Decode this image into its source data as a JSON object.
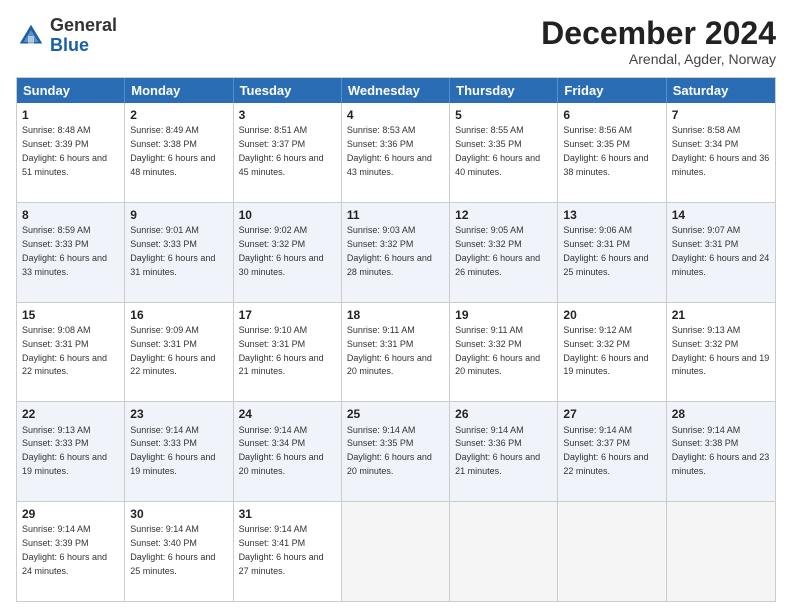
{
  "header": {
    "logo_general": "General",
    "logo_blue": "Blue",
    "month_title": "December 2024",
    "location": "Arendal, Agder, Norway"
  },
  "days_of_week": [
    "Sunday",
    "Monday",
    "Tuesday",
    "Wednesday",
    "Thursday",
    "Friday",
    "Saturday"
  ],
  "weeks": [
    [
      {
        "day": "1",
        "sunrise": "Sunrise: 8:48 AM",
        "sunset": "Sunset: 3:39 PM",
        "daylight": "Daylight: 6 hours and 51 minutes."
      },
      {
        "day": "2",
        "sunrise": "Sunrise: 8:49 AM",
        "sunset": "Sunset: 3:38 PM",
        "daylight": "Daylight: 6 hours and 48 minutes."
      },
      {
        "day": "3",
        "sunrise": "Sunrise: 8:51 AM",
        "sunset": "Sunset: 3:37 PM",
        "daylight": "Daylight: 6 hours and 45 minutes."
      },
      {
        "day": "4",
        "sunrise": "Sunrise: 8:53 AM",
        "sunset": "Sunset: 3:36 PM",
        "daylight": "Daylight: 6 hours and 43 minutes."
      },
      {
        "day": "5",
        "sunrise": "Sunrise: 8:55 AM",
        "sunset": "Sunset: 3:35 PM",
        "daylight": "Daylight: 6 hours and 40 minutes."
      },
      {
        "day": "6",
        "sunrise": "Sunrise: 8:56 AM",
        "sunset": "Sunset: 3:35 PM",
        "daylight": "Daylight: 6 hours and 38 minutes."
      },
      {
        "day": "7",
        "sunrise": "Sunrise: 8:58 AM",
        "sunset": "Sunset: 3:34 PM",
        "daylight": "Daylight: 6 hours and 36 minutes."
      }
    ],
    [
      {
        "day": "8",
        "sunrise": "Sunrise: 8:59 AM",
        "sunset": "Sunset: 3:33 PM",
        "daylight": "Daylight: 6 hours and 33 minutes."
      },
      {
        "day": "9",
        "sunrise": "Sunrise: 9:01 AM",
        "sunset": "Sunset: 3:33 PM",
        "daylight": "Daylight: 6 hours and 31 minutes."
      },
      {
        "day": "10",
        "sunrise": "Sunrise: 9:02 AM",
        "sunset": "Sunset: 3:32 PM",
        "daylight": "Daylight: 6 hours and 30 minutes."
      },
      {
        "day": "11",
        "sunrise": "Sunrise: 9:03 AM",
        "sunset": "Sunset: 3:32 PM",
        "daylight": "Daylight: 6 hours and 28 minutes."
      },
      {
        "day": "12",
        "sunrise": "Sunrise: 9:05 AM",
        "sunset": "Sunset: 3:32 PM",
        "daylight": "Daylight: 6 hours and 26 minutes."
      },
      {
        "day": "13",
        "sunrise": "Sunrise: 9:06 AM",
        "sunset": "Sunset: 3:31 PM",
        "daylight": "Daylight: 6 hours and 25 minutes."
      },
      {
        "day": "14",
        "sunrise": "Sunrise: 9:07 AM",
        "sunset": "Sunset: 3:31 PM",
        "daylight": "Daylight: 6 hours and 24 minutes."
      }
    ],
    [
      {
        "day": "15",
        "sunrise": "Sunrise: 9:08 AM",
        "sunset": "Sunset: 3:31 PM",
        "daylight": "Daylight: 6 hours and 22 minutes."
      },
      {
        "day": "16",
        "sunrise": "Sunrise: 9:09 AM",
        "sunset": "Sunset: 3:31 PM",
        "daylight": "Daylight: 6 hours and 22 minutes."
      },
      {
        "day": "17",
        "sunrise": "Sunrise: 9:10 AM",
        "sunset": "Sunset: 3:31 PM",
        "daylight": "Daylight: 6 hours and 21 minutes."
      },
      {
        "day": "18",
        "sunrise": "Sunrise: 9:11 AM",
        "sunset": "Sunset: 3:31 PM",
        "daylight": "Daylight: 6 hours and 20 minutes."
      },
      {
        "day": "19",
        "sunrise": "Sunrise: 9:11 AM",
        "sunset": "Sunset: 3:32 PM",
        "daylight": "Daylight: 6 hours and 20 minutes."
      },
      {
        "day": "20",
        "sunrise": "Sunrise: 9:12 AM",
        "sunset": "Sunset: 3:32 PM",
        "daylight": "Daylight: 6 hours and 19 minutes."
      },
      {
        "day": "21",
        "sunrise": "Sunrise: 9:13 AM",
        "sunset": "Sunset: 3:32 PM",
        "daylight": "Daylight: 6 hours and 19 minutes."
      }
    ],
    [
      {
        "day": "22",
        "sunrise": "Sunrise: 9:13 AM",
        "sunset": "Sunset: 3:33 PM",
        "daylight": "Daylight: 6 hours and 19 minutes."
      },
      {
        "day": "23",
        "sunrise": "Sunrise: 9:14 AM",
        "sunset": "Sunset: 3:33 PM",
        "daylight": "Daylight: 6 hours and 19 minutes."
      },
      {
        "day": "24",
        "sunrise": "Sunrise: 9:14 AM",
        "sunset": "Sunset: 3:34 PM",
        "daylight": "Daylight: 6 hours and 20 minutes."
      },
      {
        "day": "25",
        "sunrise": "Sunrise: 9:14 AM",
        "sunset": "Sunset: 3:35 PM",
        "daylight": "Daylight: 6 hours and 20 minutes."
      },
      {
        "day": "26",
        "sunrise": "Sunrise: 9:14 AM",
        "sunset": "Sunset: 3:36 PM",
        "daylight": "Daylight: 6 hours and 21 minutes."
      },
      {
        "day": "27",
        "sunrise": "Sunrise: 9:14 AM",
        "sunset": "Sunset: 3:37 PM",
        "daylight": "Daylight: 6 hours and 22 minutes."
      },
      {
        "day": "28",
        "sunrise": "Sunrise: 9:14 AM",
        "sunset": "Sunset: 3:38 PM",
        "daylight": "Daylight: 6 hours and 23 minutes."
      }
    ],
    [
      {
        "day": "29",
        "sunrise": "Sunrise: 9:14 AM",
        "sunset": "Sunset: 3:39 PM",
        "daylight": "Daylight: 6 hours and 24 minutes."
      },
      {
        "day": "30",
        "sunrise": "Sunrise: 9:14 AM",
        "sunset": "Sunset: 3:40 PM",
        "daylight": "Daylight: 6 hours and 25 minutes."
      },
      {
        "day": "31",
        "sunrise": "Sunrise: 9:14 AM",
        "sunset": "Sunset: 3:41 PM",
        "daylight": "Daylight: 6 hours and 27 minutes."
      },
      null,
      null,
      null,
      null
    ]
  ]
}
